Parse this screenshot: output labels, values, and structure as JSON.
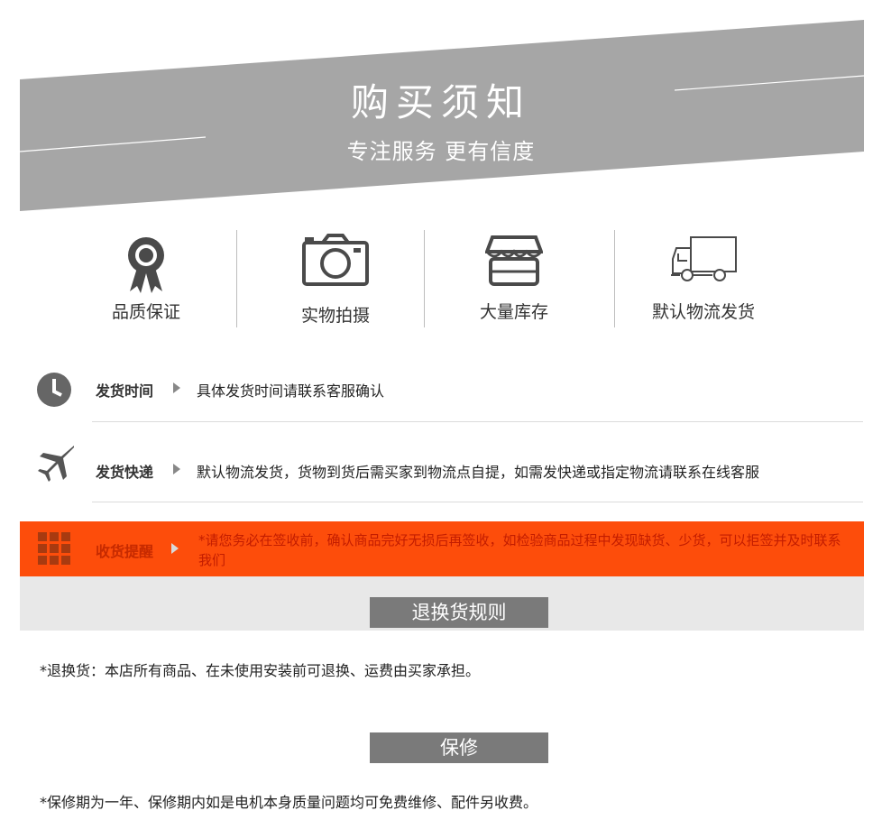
{
  "banner": {
    "title": "购买须知",
    "subtitle": "专注服务  更有信度"
  },
  "features": [
    {
      "icon": "ribbon-badge-icon",
      "label": "品质保证"
    },
    {
      "icon": "camera-icon",
      "label": "实物拍摄"
    },
    {
      "icon": "storefront-icon",
      "label": "大量库存"
    },
    {
      "icon": "truck-icon",
      "label": "默认物流发货"
    }
  ],
  "rows": {
    "shipping_time": {
      "icon": "clock-icon",
      "label": "发货时间",
      "text": "具体发货时间请联系客服确认"
    },
    "delivery": {
      "icon": "airplane-icon",
      "label": "发货快递",
      "text": "默认物流发货，货物到货后需买家到物流点自提，如需发快递或指定物流请联系在线客服"
    },
    "receipt": {
      "icon": "grid-icon",
      "label": "收货提醒",
      "text": "*请您务必在签收前，确认商品完好无损后再签收，如检验商品过程中发现缺货、少货，可以拒签并及时联系我们"
    }
  },
  "returns": {
    "heading": "退换货规则",
    "text": "*退换货：本店所有商品、在未使用安装前可退换、运费由买家承担。"
  },
  "warranty": {
    "heading": "保修",
    "text": "*保修期为一年、保修期内如是电机本身质量问题均可免费维修、配件另收费。"
  },
  "colors": {
    "banner_gray": "#a6a6a6",
    "alert_orange": "#fd4d0b",
    "alert_text": "#c31d00",
    "section_head": "#7a7a7a"
  }
}
